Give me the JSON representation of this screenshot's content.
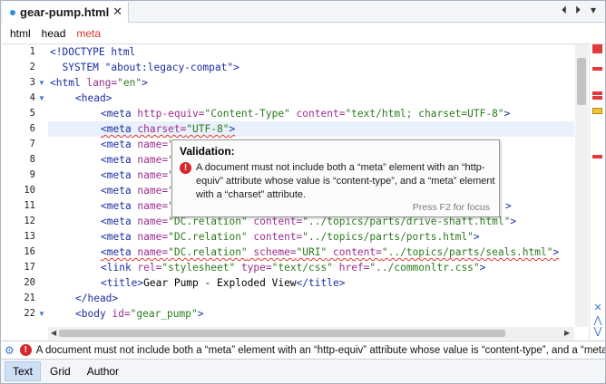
{
  "tab": {
    "title": "gear-pump.html",
    "close": "✕"
  },
  "tab_nav": {
    "prev": "⏴",
    "next": "⏵",
    "menu": "▾"
  },
  "breadcrumb": [
    "html",
    "head",
    "meta"
  ],
  "line_numbers": [
    "1",
    "2",
    "3",
    "4",
    "5",
    "6",
    "7",
    "8",
    "9",
    "10",
    "11",
    "12",
    "13",
    "16",
    "17",
    "20",
    "21",
    "22"
  ],
  "code": {
    "l1": "<!DOCTYPE html",
    "l2": "  SYSTEM \"about:legacy-compat\">",
    "l3_tag": "<html",
    "l3_attr": " lang=",
    "l3_val": "\"en\"",
    "l3_end": ">",
    "l4": "<head>",
    "l5_tag": "<meta",
    "l5_attr1": " http-equiv=",
    "l5_val1": "\"Content-Type\"",
    "l5_attr2": " content=",
    "l5_val2": "\"text/html; charset=UTF-8\"",
    "l5_end": ">",
    "l6_tag": "<meta",
    "l6_attr": " charset=",
    "l6_val": "\"UTF-8\"",
    "l6_end": ">",
    "meta_tag": "<meta",
    "name_attr": " name=",
    "name_frag": "\"",
    "l11_tail": ">",
    "l12_tag": "<meta",
    "l12_attr1": " name=",
    "l12_val1": "\"DC.relation\"",
    "l12_attr2": " content=",
    "l12_val2": "\"../topics/parts/drive-shaft.html\"",
    "l12_end": ">",
    "l13_val2": "\"../topics/parts/ports.html\"",
    "l16_attr2": " scheme=",
    "l16_val2": "\"URI\"",
    "l16_attr3": " content=",
    "l16_val3": "\"../topics/parts/seals.html\"",
    "l17_tag": "<link",
    "l17_attr1": " rel=",
    "l17_val1": "\"stylesheet\"",
    "l17_attr2": " type=",
    "l17_val2": "\"text/css\"",
    "l17_attr3": " href=",
    "l17_val3": "\"../commonltr.css\"",
    "l17_end": ">",
    "l20_open": "<title>",
    "l20_text": "Gear Pump - Exploded View",
    "l20_close": "</title>",
    "l21": "</head>",
    "l22_tag": "<body",
    "l22_attr": " id=",
    "l22_val": "\"gear_pump\"",
    "l22_end": ">"
  },
  "tooltip": {
    "title": "Validation:",
    "message": "A document must not include both a “meta” element with an “http-equiv” attribute whose value is “content-type”, and a “meta” element with a “charset” attribute.",
    "footer": "Press F2 for focus"
  },
  "status": {
    "message": "A document must not include both a “meta” element with an “http-equiv” attribute whose value is “content-type”, and a “meta” element with a “charset” attribute."
  },
  "modes": [
    "Text",
    "Grid",
    "Author"
  ],
  "colors": {
    "tag": "#1b2fa0",
    "attribute": "#9b2d8f",
    "value": "#2b7a1d",
    "error": "#e33b3b",
    "warning": "#f2c43a",
    "accent": "#3a78c7"
  }
}
